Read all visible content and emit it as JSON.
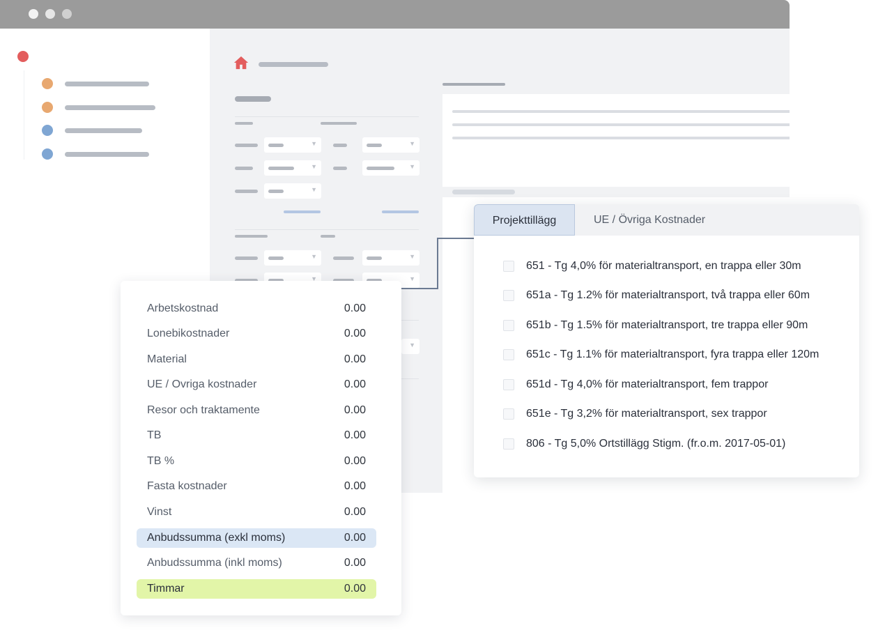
{
  "tabs": {
    "items": [
      "Projekttillägg",
      "UE / Övriga Kostnader"
    ],
    "active": "Projekttillägg"
  },
  "options": [
    "651 - Tg 4,0% för materialtransport, en trappa eller 30m",
    "651a - Tg 1.2% för materialtransport, två trappa eller 60m",
    "651b - Tg 1.5% för materialtransport, tre trappa eller 90m",
    "651c - Tg 1.1% för materialtransport, fyra trappa eller 120m",
    "651d - Tg 4,0% för materialtransport, fem trappor",
    "651e - Tg 3,2% för materialtransport, sex trappor",
    "806 - Tg 5,0% Ortstillägg Stigm. (fr.o.m. 2017-05-01)"
  ],
  "costs": [
    {
      "label": "Arbetskostnad",
      "value": "0.00"
    },
    {
      "label": "Lonebikostnader",
      "value": "0.00"
    },
    {
      "label": "Material",
      "value": "0.00"
    },
    {
      "label": "UE / Ovriga kostnader",
      "value": "0.00"
    },
    {
      "label": "Resor och traktamente",
      "value": "0.00"
    },
    {
      "label": "TB",
      "value": "0.00"
    },
    {
      "label": "TB %",
      "value": "0.00"
    },
    {
      "label": "Fasta kostnader",
      "value": "0.00"
    },
    {
      "label": "Vinst",
      "value": "0.00"
    },
    {
      "label": "Anbudssumma (exkl moms)",
      "value": "0.00"
    },
    {
      "label": "Anbudssumma (inkl moms)",
      "value": "0.00"
    },
    {
      "label": "Timmar",
      "value": "0.00"
    }
  ],
  "colors": {
    "accent_red": "#e35d5d",
    "bullet_orange": "#e8a870",
    "bullet_blue": "#7fa6d3",
    "highlight_blue": "#dbe7f5",
    "highlight_green": "#e2f5a8",
    "connector": "#6b7a92"
  },
  "icons": {
    "home": "home-icon",
    "caret": "chevron-down-icon"
  }
}
